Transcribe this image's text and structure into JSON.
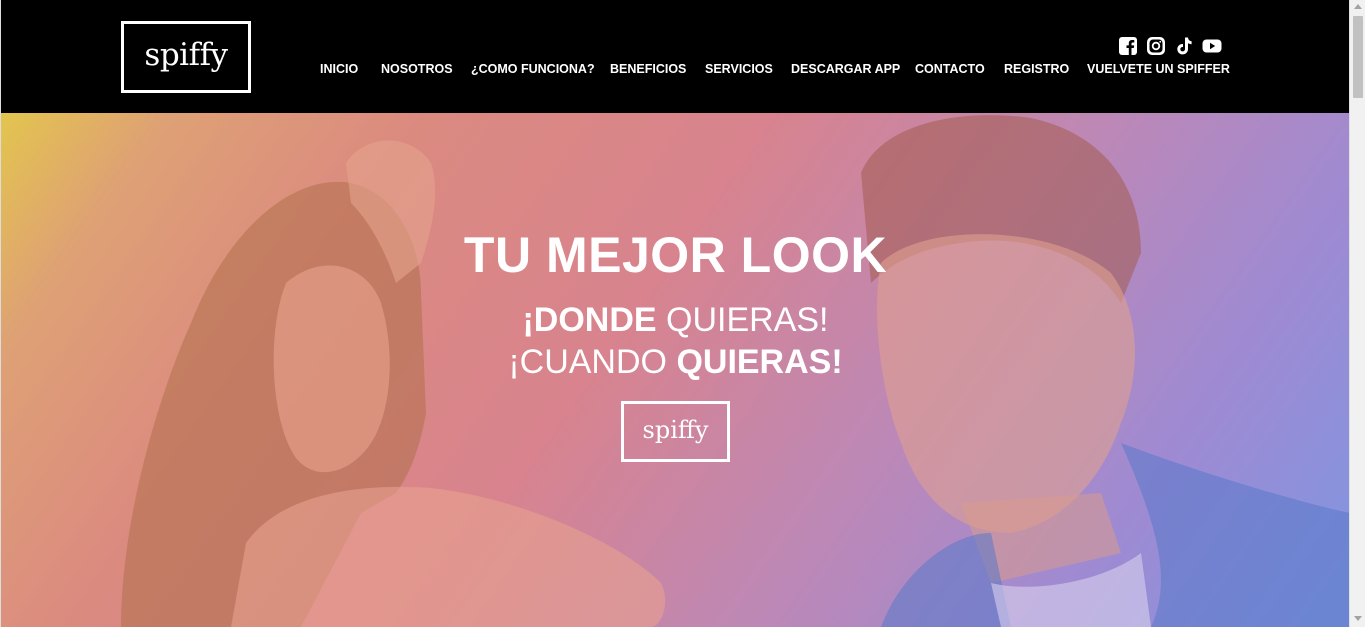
{
  "brand": {
    "logo_text": "spiffy"
  },
  "social": {
    "icons": [
      "facebook-icon",
      "instagram-icon",
      "tiktok-icon",
      "youtube-icon"
    ]
  },
  "nav": {
    "items": [
      "INICIO",
      "NOSOTROS",
      "¿COMO FUNCIONA?",
      "BENEFICIOS",
      "SERVICIOS",
      "DESCARGAR APP",
      "CONTACTO",
      "REGISTRO",
      "VUELVETE UN SPIFFER"
    ]
  },
  "hero": {
    "title": "TU MEJOR LOOK",
    "line1_bold": "¡DONDE",
    "line1_rest": " QUIERAS!",
    "line2_rest": "¡CUANDO ",
    "line2_bold": "QUIERAS!",
    "logo_text": "spiffy"
  },
  "colors": {
    "header_bg": "#000000",
    "text": "#ffffff",
    "gradient": [
      "#e3c54e",
      "#db8a80",
      "#bd88b6",
      "#7f96e2"
    ]
  }
}
